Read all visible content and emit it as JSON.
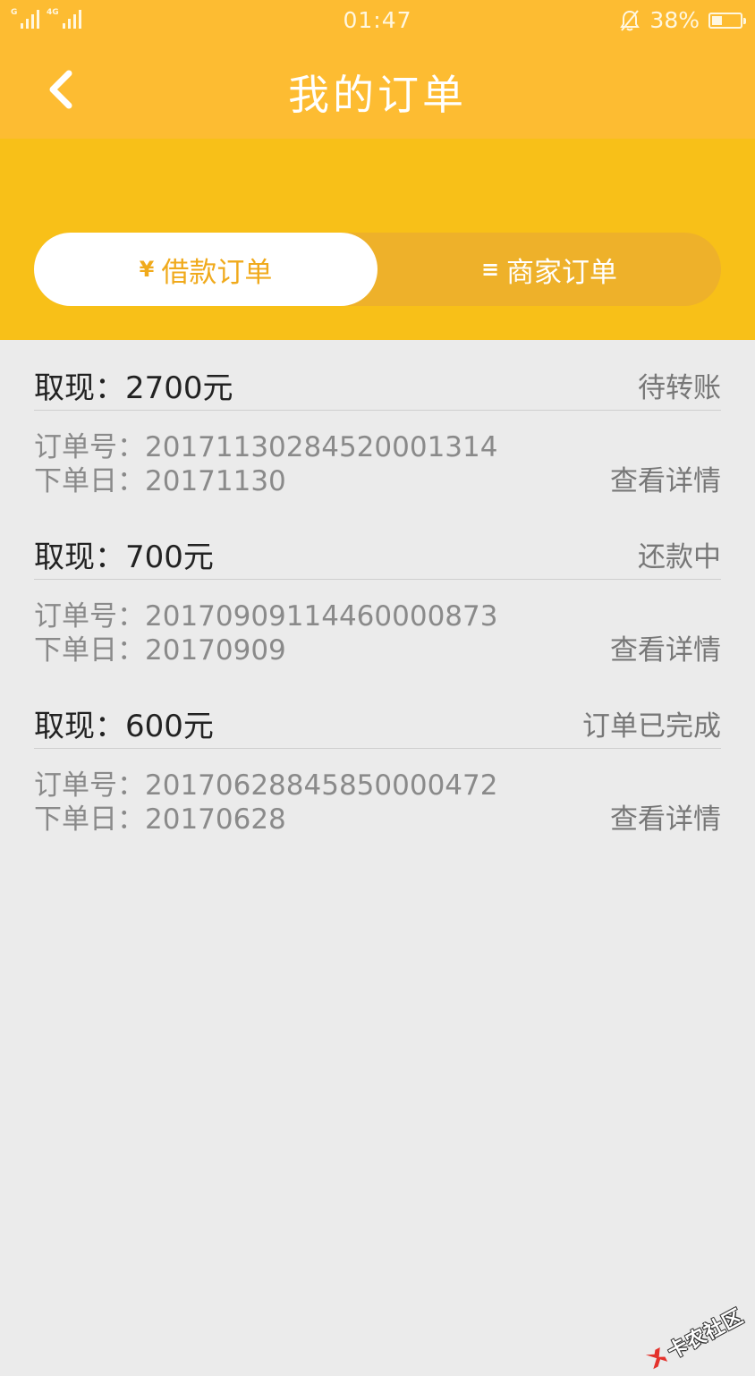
{
  "status_bar": {
    "sim1_label": "G",
    "sim2_label": "4G",
    "time": "01:47",
    "battery": "38%",
    "battery_level": 0.38
  },
  "header": {
    "title": "我的订单",
    "back_icon": "chevron-left-icon"
  },
  "tabs": [
    {
      "icon": "¥",
      "label": "借款订单",
      "active": true
    },
    {
      "icon": "≡",
      "label": "商家订单",
      "active": false
    }
  ],
  "orders": [
    {
      "amount": "取现：2700元",
      "status": "待转账",
      "order_no": "订单号：20171130284520001314",
      "order_date": "下单日：20171130",
      "detail": "查看详情"
    },
    {
      "amount": "取现：700元",
      "status": "还款中",
      "order_no": "订单号：20170909114460000873",
      "order_date": "下单日：20170909",
      "detail": "查看详情"
    },
    {
      "amount": "取现：600元",
      "status": "订单已完成",
      "order_no": "订单号：20170628845850000472",
      "order_date": "下单日：20170628",
      "detail": "查看详情"
    }
  ],
  "watermark": {
    "text": "卡农社区"
  },
  "colors": {
    "header_bg": "#fdbc32",
    "tab_band_bg": "#f8c018",
    "accent": "#f0aa1c",
    "list_bg": "#ebebeb"
  }
}
